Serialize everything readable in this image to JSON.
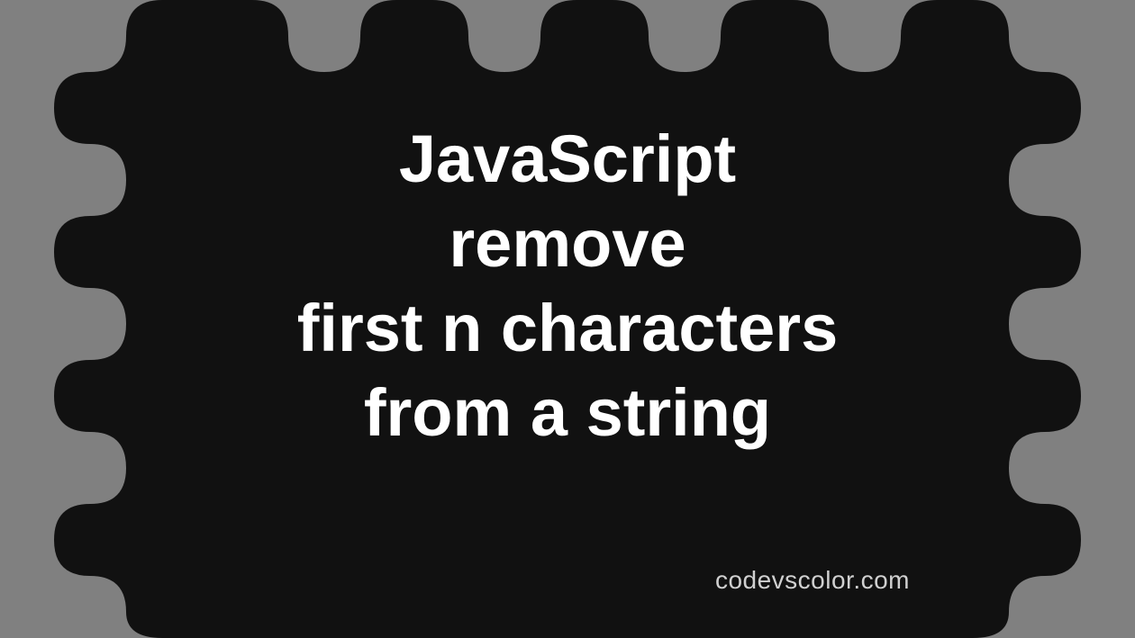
{
  "title": {
    "line1": "JavaScript",
    "line2": "remove",
    "line3": "first n characters",
    "line4": "from a string"
  },
  "watermark": "codevscolor.com",
  "colors": {
    "background": "#808080",
    "blob": "#111111",
    "text": "#ffffff",
    "watermark": "#d0d0d0"
  }
}
